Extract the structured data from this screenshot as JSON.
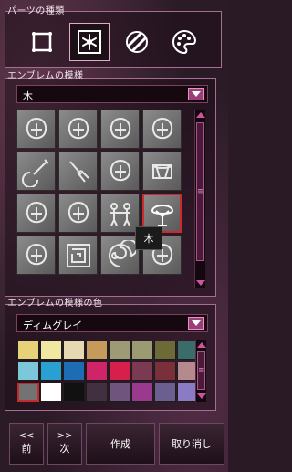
{
  "parts_panel": {
    "title": "パーツの種類",
    "types": [
      {
        "name": "frame",
        "icon": "square-frame-icon",
        "selected": false
      },
      {
        "name": "emblem",
        "icon": "snowflake-emblem-icon",
        "selected": true
      },
      {
        "name": "pattern",
        "icon": "swirl-pattern-icon",
        "selected": false
      },
      {
        "name": "color",
        "icon": "palette-icon",
        "selected": false
      }
    ]
  },
  "emblem_panel": {
    "title": "エンブレムの模様",
    "selected_value": "木",
    "tooltip": "木",
    "icons": [
      "leaf-emblem-icon",
      "chef-hat-icon",
      "armchair-icon",
      "onion-icon",
      "lute-icon",
      "broom-icon",
      "mirror-icon",
      "drum-icon",
      "hands-heart-icon",
      "witch-hat-icon",
      "children-icon",
      "tree-icon",
      "swirl-ornament-icon",
      "maze-icon",
      "ammonite-icon",
      "rune-icon",
      "knot-icon"
    ]
  },
  "color_panel": {
    "title": "エンブレムの模様の色",
    "selected_value": "ディムグレイ",
    "swatches": [
      "#e7d27a",
      "#f0e7a3",
      "#e6d8b0",
      "#c59a5a",
      "#9d9a76",
      "#9b9b73",
      "#6e6a38",
      "#3a6d6a",
      "#7cc7d9",
      "#2a9fd1",
      "#1e6cb3",
      "#cf2467",
      "#d61f4b",
      "#7b3a52",
      "#7a2f3a",
      "#b48a8f",
      "#737373",
      "#ffffff",
      "#111111",
      "#403040",
      "#6f547e",
      "#9a3a8e",
      "#6a5f8f",
      "#8a7cc4"
    ],
    "selected_index": 16
  },
  "buttons": {
    "prev_arrows": "<<",
    "prev_label": "前",
    "next_arrows": ">>",
    "next_label": "次",
    "create_label": "作成",
    "cancel_label": "取り消し"
  },
  "colors": {
    "accent": "#d1529f",
    "border": "#a76e93",
    "selection": "#cc2b2b"
  }
}
